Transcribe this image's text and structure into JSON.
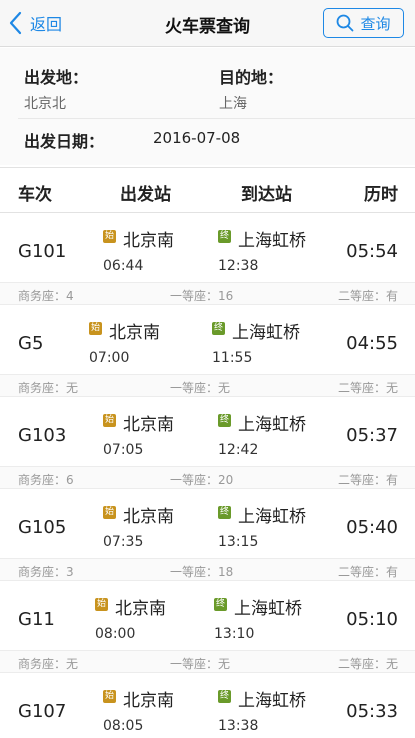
{
  "header": {
    "back_label": "返回",
    "title": "火车票查询",
    "query_label": "查询",
    "accent_color": "#1e88e5"
  },
  "form": {
    "from_label": "出发地：",
    "from_value": "北京北",
    "to_label": "目的地：",
    "to_value": "上海",
    "date_label": "出发日期：",
    "date_value": "2016-07-08"
  },
  "table": {
    "columns": [
      "车次",
      "出发站",
      "到达站",
      "历时"
    ],
    "start_icon": "始",
    "end_icon": "终",
    "rows": [
      {
        "code": "G101",
        "dep_station": "北京南",
        "dep_time": "06:44",
        "arr_station": "上海虹桥",
        "arr_time": "12:38",
        "duration": "05:54",
        "business": "商务座：4",
        "first": "一等座：16",
        "second": "二等座：有"
      },
      {
        "code": "G5",
        "dep_station": "北京南",
        "dep_time": "07:00",
        "arr_station": "上海虹桥",
        "arr_time": "11:55",
        "duration": "04:55",
        "business": "商务座：无",
        "first": "一等座：无",
        "second": "二等座：无"
      },
      {
        "code": "G103",
        "dep_station": "北京南",
        "dep_time": "07:05",
        "arr_station": "上海虹桥",
        "arr_time": "12:42",
        "duration": "05:37",
        "business": "商务座：6",
        "first": "一等座：20",
        "second": "二等座：有"
      },
      {
        "code": "G105",
        "dep_station": "北京南",
        "dep_time": "07:35",
        "arr_station": "上海虹桥",
        "arr_time": "13:15",
        "duration": "05:40",
        "business": "商务座：3",
        "first": "一等座：18",
        "second": "二等座：有"
      },
      {
        "code": "G11",
        "dep_station": "北京南",
        "dep_time": "08:00",
        "arr_station": "上海虹桥",
        "arr_time": "13:10",
        "duration": "05:10",
        "business": "商务座：无",
        "first": "一等座：无",
        "second": "二等座：无"
      },
      {
        "code": "G107",
        "dep_station": "北京南",
        "dep_time": "08:05",
        "arr_station": "上海虹桥",
        "arr_time": "13:38",
        "duration": "05:33",
        "business": "",
        "first": "",
        "second": ""
      }
    ]
  }
}
